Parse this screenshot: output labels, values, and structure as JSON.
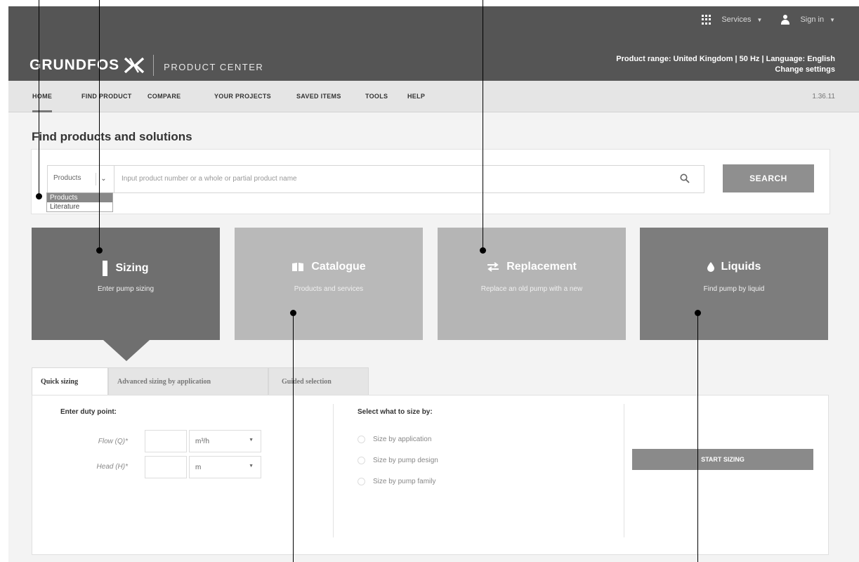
{
  "header": {
    "services_label": "Services",
    "signin_label": "Sign in",
    "brand": "GRUNDFOS",
    "product_center": "PRODUCT CENTER",
    "range_line": "Product range: United Kingdom | 50 Hz | Language: English",
    "change_settings": "Change settings"
  },
  "nav": {
    "items": [
      "HOME",
      "FIND PRODUCT",
      "COMPARE",
      "YOUR PROJECTS",
      "SAVED ITEMS",
      "TOOLS",
      "HELP"
    ],
    "active": "HOME",
    "version": "1.36.11"
  },
  "search": {
    "title": "Find products and solutions",
    "selected": "Products",
    "options": [
      "Products",
      "Literature"
    ],
    "placeholder": "Input product number or a whole or partial product name",
    "button": "SEARCH"
  },
  "tiles": [
    {
      "title": "Sizing",
      "subtitle": "Enter pump sizing",
      "icon": "sizing-bar-icon"
    },
    {
      "title": "Catalogue",
      "subtitle": "Products and services",
      "icon": "book-icon"
    },
    {
      "title": "Replacement",
      "subtitle": "Replace an old pump with a new",
      "icon": "swap-arrows-icon"
    },
    {
      "title": "Liquids",
      "subtitle": "Find pump by liquid",
      "icon": "drop-icon"
    }
  ],
  "tabs": [
    "Quick sizing",
    "Advanced sizing by application",
    "Guided selection"
  ],
  "sizing": {
    "duty_heading": "Enter duty point:",
    "flow_label": "Flow (Q)*",
    "flow_unit": "m³/h",
    "head_label": "Head (H)*",
    "head_unit": "m",
    "select_heading": "Select what to size by:",
    "options": [
      "Size by application",
      "Size by pump design",
      "Size by pump family"
    ],
    "start_button": "START SIZING"
  }
}
